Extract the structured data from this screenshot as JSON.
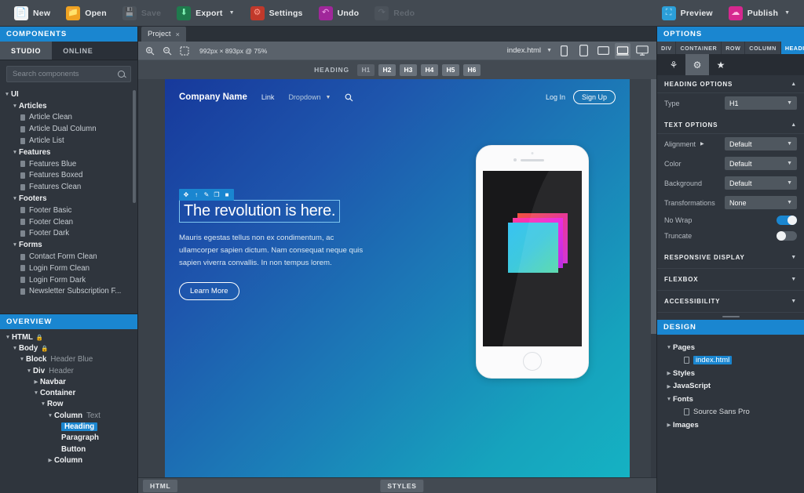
{
  "toolbar": {
    "items": [
      {
        "label": "New",
        "icon": "new-document-icon",
        "disabled": false
      },
      {
        "label": "Open",
        "icon": "open-folder-icon",
        "disabled": false
      },
      {
        "label": "Save",
        "icon": "save-disk-icon",
        "disabled": true
      },
      {
        "label": "Export",
        "icon": "export-icon",
        "disabled": false,
        "caret": true
      },
      {
        "label": "Settings",
        "icon": "settings-gear-icon",
        "disabled": false
      },
      {
        "label": "Undo",
        "icon": "undo-arrow-icon",
        "disabled": false
      },
      {
        "label": "Redo",
        "icon": "redo-arrow-icon",
        "disabled": true
      }
    ],
    "right": [
      {
        "label": "Preview",
        "icon": "preview-monitor-icon",
        "caret": false
      },
      {
        "label": "Publish",
        "icon": "publish-cloud-icon",
        "caret": true
      }
    ]
  },
  "components_panel": {
    "title": "COMPONENTS",
    "tabs": [
      {
        "label": "STUDIO",
        "active": true
      },
      {
        "label": "ONLINE",
        "active": false
      }
    ],
    "search": {
      "placeholder": "Search components",
      "value": ""
    },
    "tree": [
      {
        "level": 0,
        "label": "UI",
        "type": "group",
        "expanded": true
      },
      {
        "level": 1,
        "label": "Articles",
        "type": "group",
        "expanded": true
      },
      {
        "level": 2,
        "label": "Article Clean",
        "type": "item"
      },
      {
        "level": 2,
        "label": "Article Dual Column",
        "type": "item"
      },
      {
        "level": 2,
        "label": "Article List",
        "type": "item"
      },
      {
        "level": 1,
        "label": "Features",
        "type": "group",
        "expanded": true
      },
      {
        "level": 2,
        "label": "Features Blue",
        "type": "item"
      },
      {
        "level": 2,
        "label": "Features Boxed",
        "type": "item"
      },
      {
        "level": 2,
        "label": "Features Clean",
        "type": "item"
      },
      {
        "level": 1,
        "label": "Footers",
        "type": "group",
        "expanded": true
      },
      {
        "level": 2,
        "label": "Footer Basic",
        "type": "item"
      },
      {
        "level": 2,
        "label": "Footer Clean",
        "type": "item"
      },
      {
        "level": 2,
        "label": "Footer Dark",
        "type": "item"
      },
      {
        "level": 1,
        "label": "Forms",
        "type": "group",
        "expanded": true
      },
      {
        "level": 2,
        "label": "Contact Form Clean",
        "type": "item"
      },
      {
        "level": 2,
        "label": "Login Form Clean",
        "type": "item"
      },
      {
        "level": 2,
        "label": "Login Form Dark",
        "type": "item"
      },
      {
        "level": 2,
        "label": "Newsletter Subscription F...",
        "type": "item"
      }
    ]
  },
  "overview_panel": {
    "title": "OVERVIEW",
    "tree": [
      {
        "indent": 0,
        "tag": "HTML",
        "sub": "",
        "expanded": true,
        "locked": true,
        "selected": false
      },
      {
        "indent": 1,
        "tag": "Body",
        "sub": "",
        "expanded": true,
        "locked": true,
        "selected": false
      },
      {
        "indent": 2,
        "tag": "Block",
        "sub": "Header Blue",
        "expanded": true,
        "locked": false,
        "selected": false
      },
      {
        "indent": 3,
        "tag": "Div",
        "sub": "Header",
        "expanded": true,
        "locked": false,
        "selected": false
      },
      {
        "indent": 4,
        "tag": "Navbar",
        "sub": "",
        "expanded": false,
        "locked": false,
        "selected": false
      },
      {
        "indent": 4,
        "tag": "Container",
        "sub": "",
        "expanded": true,
        "locked": false,
        "selected": false
      },
      {
        "indent": 5,
        "tag": "Row",
        "sub": "",
        "expanded": true,
        "locked": false,
        "selected": false
      },
      {
        "indent": 6,
        "tag": "Column",
        "sub": "Text",
        "expanded": true,
        "locked": false,
        "selected": false
      },
      {
        "indent": 7,
        "tag": "Heading",
        "sub": "",
        "expanded": null,
        "locked": false,
        "selected": true
      },
      {
        "indent": 7,
        "tag": "Paragraph",
        "sub": "",
        "expanded": null,
        "locked": false,
        "selected": false
      },
      {
        "indent": 7,
        "tag": "Button",
        "sub": "",
        "expanded": null,
        "locked": false,
        "selected": false
      },
      {
        "indent": 6,
        "tag": "Column",
        "sub": "",
        "expanded": false,
        "locked": false,
        "selected": false
      }
    ]
  },
  "editor": {
    "tab": {
      "label": "Project",
      "close": "×"
    },
    "canvas_tools": {
      "zoom_in_icon": "zoom-in-icon",
      "zoom_out_icon": "zoom-out-icon",
      "fit_icon": "fit-to-screen-icon",
      "dimensions": "992px × 893px @ 75%",
      "file": "index.html",
      "devices": [
        {
          "name": "device-phone-portrait",
          "active": false
        },
        {
          "name": "device-phone-large",
          "active": false
        },
        {
          "name": "device-tablet",
          "active": false
        },
        {
          "name": "device-laptop",
          "active": true
        },
        {
          "name": "device-desktop",
          "active": false
        }
      ]
    },
    "heading_bar": {
      "label": "HEADING",
      "buttons": [
        {
          "label": "H1",
          "active": true
        },
        {
          "label": "H2",
          "active": false
        },
        {
          "label": "H3",
          "active": false
        },
        {
          "label": "H4",
          "active": false
        },
        {
          "label": "H5",
          "active": false
        },
        {
          "label": "H6",
          "active": false
        }
      ]
    },
    "statusbar": {
      "html_label": "HTML",
      "styles_label": "STYLES"
    }
  },
  "page_preview": {
    "navbar": {
      "brand": "Company Name",
      "links": [
        {
          "label": "Link",
          "dim": false
        },
        {
          "label": "Dropdown",
          "dim": true,
          "caret": true
        }
      ],
      "search_icon": "search-icon",
      "login": "Log In",
      "signup": "Sign Up"
    },
    "selection_toolbar": {
      "move_icon": "move-handle-icon",
      "parent_icon": "select-parent-icon",
      "edit_icon": "edit-pencil-icon",
      "duplicate_icon": "duplicate-icon",
      "delete_icon": "delete-trash-icon"
    },
    "hero": {
      "heading": "The revolution is here.",
      "paragraph": "Mauris egestas tellus non ex condimentum, ac ullamcorper sapien dictum. Nam consequat neque quis sapien viverra convallis. In non tempus lorem.",
      "button": "Learn More"
    },
    "colors": {
      "gradient_start": "#17399b",
      "gradient_end": "#15b2c3",
      "accent_blue": "#1a86d0"
    }
  },
  "options_panel": {
    "title": "OPTIONS",
    "breadcrumbs": [
      {
        "label": "DIV",
        "active": false
      },
      {
        "label": "CONTAINER",
        "active": false
      },
      {
        "label": "ROW",
        "active": false
      },
      {
        "label": "COLUMN",
        "active": false
      },
      {
        "label": "HEADING",
        "active": true
      }
    ],
    "icon_tabs": [
      {
        "name": "palette-icon",
        "glyph": "⚘",
        "active": false
      },
      {
        "name": "gear-icon",
        "glyph": "⚙",
        "active": true
      },
      {
        "name": "star-badge-icon",
        "glyph": "★",
        "active": false
      }
    ],
    "heading_options": {
      "title": "HEADING OPTIONS",
      "caret": "▲",
      "rows": [
        {
          "label": "Type",
          "value": "H1"
        }
      ]
    },
    "text_options": {
      "title": "TEXT OPTIONS",
      "caret": "▲",
      "selects": [
        {
          "label": "Alignment",
          "value": "Default",
          "sub_caret": true
        },
        {
          "label": "Color",
          "value": "Default",
          "sub_caret": false
        },
        {
          "label": "Background",
          "value": "Default",
          "sub_caret": false
        },
        {
          "label": "Transformations",
          "value": "None",
          "sub_caret": false
        }
      ],
      "toggles": [
        {
          "label": "No Wrap",
          "on": true
        },
        {
          "label": "Truncate",
          "on": false
        }
      ]
    },
    "collapsed_sections": [
      {
        "title": "RESPONSIVE DISPLAY",
        "caret": "▼"
      },
      {
        "title": "FLEXBOX",
        "caret": "▼"
      },
      {
        "title": "ACCESSIBILITY",
        "caret": "▼"
      }
    ]
  },
  "design_panel": {
    "title": "DESIGN",
    "tree": [
      {
        "indent": 0,
        "label": "Pages",
        "expanded": true,
        "bold": true,
        "selected": false,
        "file": false
      },
      {
        "indent": 1,
        "label": "index.html",
        "expanded": null,
        "bold": false,
        "selected": true,
        "file": true
      },
      {
        "indent": 0,
        "label": "Styles",
        "expanded": false,
        "bold": true,
        "selected": false,
        "file": false
      },
      {
        "indent": 0,
        "label": "JavaScript",
        "expanded": false,
        "bold": true,
        "selected": false,
        "file": false
      },
      {
        "indent": 0,
        "label": "Fonts",
        "expanded": true,
        "bold": true,
        "selected": false,
        "file": false
      },
      {
        "indent": 1,
        "label": "Source Sans Pro",
        "expanded": null,
        "bold": false,
        "selected": false,
        "file": true
      },
      {
        "indent": 0,
        "label": "Images",
        "expanded": false,
        "bold": true,
        "selected": false,
        "file": false
      }
    ]
  }
}
